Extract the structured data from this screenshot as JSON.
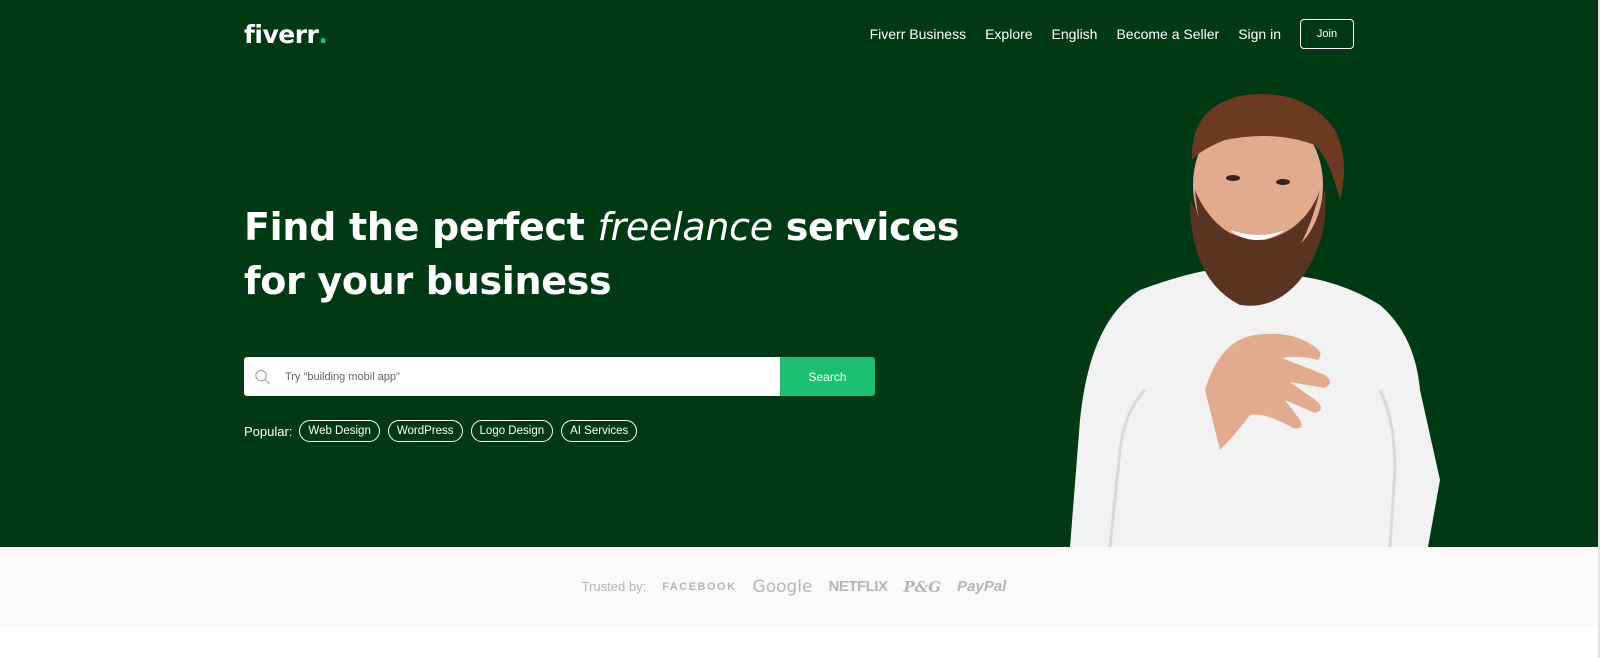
{
  "header": {
    "logo_text": "fiverr",
    "logo_dot": ".",
    "nav": [
      "Fiverr Business",
      "Explore",
      "English",
      "Become a Seller",
      "Sign in"
    ],
    "join_label": "Join"
  },
  "hero": {
    "headline_part1": "Find the perfect ",
    "headline_italic": "freelance",
    "headline_part2": " services",
    "headline_line2": "for your business",
    "search": {
      "placeholder": "Try \"building mobil app\"",
      "button_label": "Search"
    },
    "popular_label": "Popular:",
    "popular_tags": [
      "Web Design",
      "WordPress",
      "Logo Design",
      "AI Services"
    ]
  },
  "trusted": {
    "label": "Trusted by:",
    "brands": [
      "FACEBOOK",
      "Google",
      "NETFLIX",
      "P&G",
      "PayPal"
    ]
  },
  "colors": {
    "hero_background": "#013914",
    "brand_green": "#1dbf73",
    "trusted_background": "#fafafa",
    "muted_text": "#b5b6ba"
  },
  "icons": {
    "search": "search-icon"
  }
}
